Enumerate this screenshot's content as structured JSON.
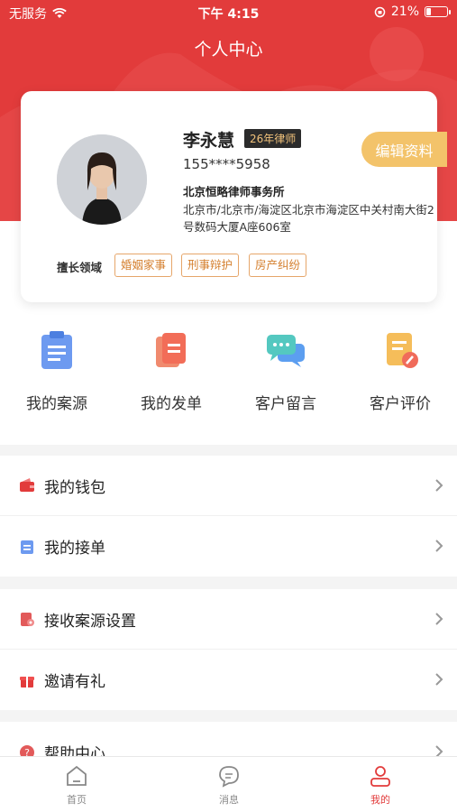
{
  "status_bar": {
    "carrier": "无服务",
    "time": "下午 4:15",
    "battery_pct": "21%",
    "battery_level": 0.21
  },
  "nav": {
    "title": "个人中心"
  },
  "profile": {
    "name": "李永慧",
    "years_badge": "26年律师",
    "phone": "155****5958",
    "firm": "北京恒略律师事务所",
    "address": "北京市/北京市/海淀区北京市海淀区中关村南大街2号数码大厦A座606室",
    "edit_button": "编辑资料",
    "specialty_label": "擅长领域",
    "specialties": [
      "婚姻家事",
      "刑事辩护",
      "房产纠纷"
    ]
  },
  "quick_actions": [
    {
      "label": "我的案源",
      "icon": "clipboard-icon"
    },
    {
      "label": "我的发单",
      "icon": "document-icon"
    },
    {
      "label": "客户留言",
      "icon": "chat-bubbles-icon"
    },
    {
      "label": "客户评价",
      "icon": "review-icon"
    }
  ],
  "menu": {
    "wallet": "我的钱包",
    "orders": "我的接单",
    "case_settings": "接收案源设置",
    "invite": "邀请有礼",
    "help": "帮助中心"
  },
  "tabbar": {
    "home": "首页",
    "messages": "消息",
    "mine": "我的"
  },
  "colors": {
    "brand_red": "#e23b3b",
    "gold": "#f3c36a",
    "tag_orange": "#d47f2e"
  }
}
